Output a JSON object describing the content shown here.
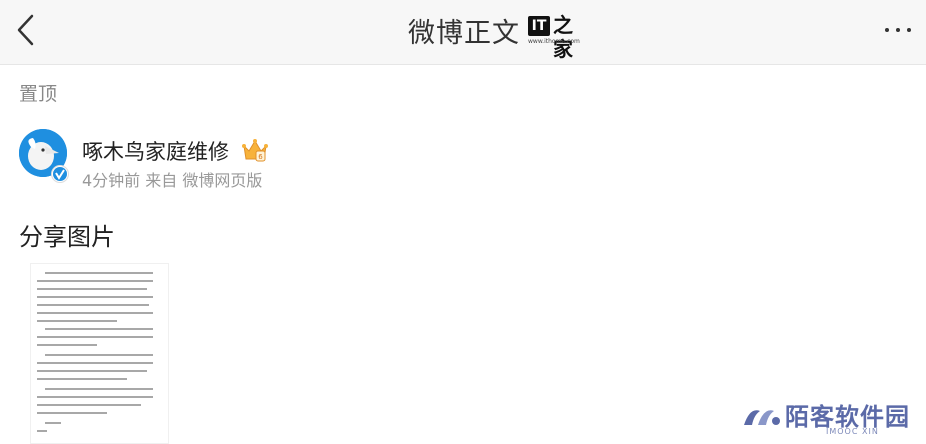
{
  "header": {
    "back_icon": "chevron-left-icon",
    "title": "微博正文",
    "logo_mark": "IT",
    "logo_chinese": "之家",
    "logo_url": "www.ithome.com",
    "more_icon": "more-dots-icon"
  },
  "post": {
    "pinned_label": "置顶",
    "author": "啄木鸟家庭维修",
    "meta": "4分钟前 来自 微博网页版",
    "text": "分享图片",
    "badge_icon": "crown-badge-icon",
    "verified_icon": "verified-icon"
  },
  "watermark": {
    "name": "陌客软件园",
    "sub": "IMOOC XIN"
  },
  "colors": {
    "accent_blue": "#1f8fe0",
    "meta_gray": "#999999",
    "watermark_blue": "#5b6aa8"
  }
}
